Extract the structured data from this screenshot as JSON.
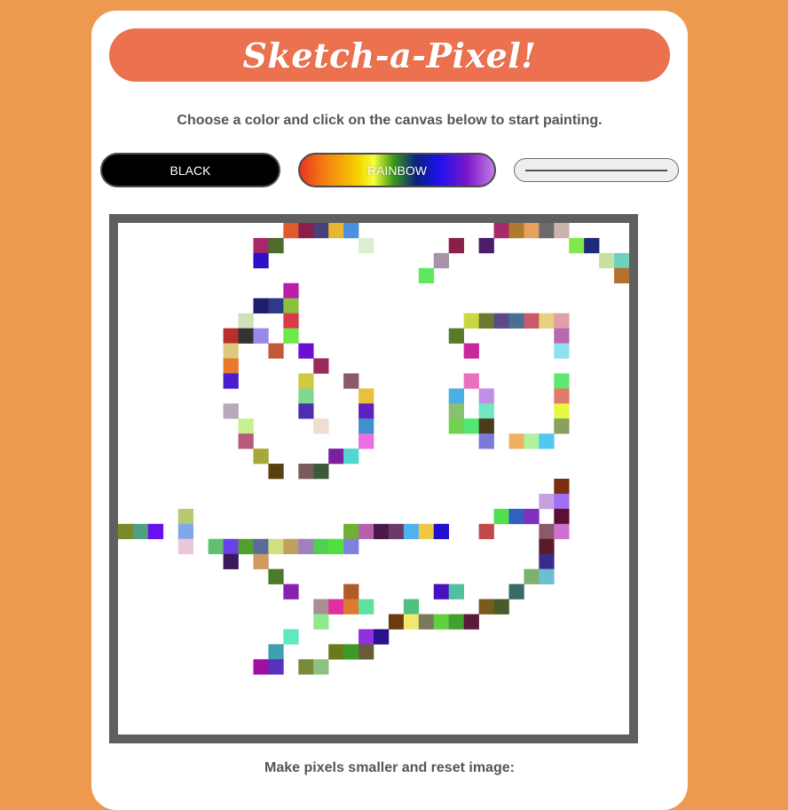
{
  "header": {
    "title": "Sketch-a-Pixel!"
  },
  "instructions": "Choose a color and click on the canvas below to start painting.",
  "controls": {
    "black_label": "BLACK",
    "rainbow_label": "RAINBOW"
  },
  "footer": {
    "text": "Make pixels smaller and reset image:"
  },
  "colors": {
    "page_background": "#ED9A50",
    "title_background": "#EC714E",
    "canvas_border": "#5f5f5f"
  },
  "canvas": {
    "columns": 34,
    "rows": 34,
    "cells": [
      [
        11,
        0,
        "#E05A2A"
      ],
      [
        12,
        0,
        "#8B1E4B"
      ],
      [
        13,
        0,
        "#4B3F7A"
      ],
      [
        14,
        0,
        "#E6B830"
      ],
      [
        15,
        0,
        "#4A8FE0"
      ],
      [
        25,
        0,
        "#A8286A"
      ],
      [
        26,
        0,
        "#B07A2E"
      ],
      [
        27,
        0,
        "#E8A060"
      ],
      [
        28,
        0,
        "#6B6B6B"
      ],
      [
        29,
        0,
        "#CCB3AD"
      ],
      [
        9,
        1,
        "#A8286A"
      ],
      [
        10,
        1,
        "#4F6B2E"
      ],
      [
        16,
        1,
        "#D9F0CF"
      ],
      [
        22,
        1,
        "#8B1E4B"
      ],
      [
        24,
        1,
        "#4A1E6B"
      ],
      [
        30,
        1,
        "#7FE84A"
      ],
      [
        31,
        1,
        "#1E2A7A"
      ],
      [
        9,
        2,
        "#2D10C8"
      ],
      [
        21,
        2,
        "#A893A8"
      ],
      [
        32,
        2,
        "#C5E0A0"
      ],
      [
        33,
        2,
        "#6FD0C0"
      ],
      [
        20,
        3,
        "#5FE85F"
      ],
      [
        33,
        3,
        "#B5702E"
      ],
      [
        11,
        4,
        "#B81EA8"
      ],
      [
        9,
        5,
        "#1E1E6B"
      ],
      [
        10,
        5,
        "#2E3A8C"
      ],
      [
        11,
        5,
        "#8CC040"
      ],
      [
        8,
        6,
        "#D0E0B8"
      ],
      [
        11,
        6,
        "#D93A4A"
      ],
      [
        23,
        6,
        "#C8D840"
      ],
      [
        24,
        6,
        "#6B7A2E"
      ],
      [
        25,
        6,
        "#5A4A8A"
      ],
      [
        26,
        6,
        "#4A7090"
      ],
      [
        27,
        6,
        "#C85A6A"
      ],
      [
        28,
        6,
        "#E8D080"
      ],
      [
        29,
        6,
        "#E0A0A8"
      ],
      [
        7,
        7,
        "#B8302A"
      ],
      [
        8,
        7,
        "#333333"
      ],
      [
        9,
        7,
        "#9B88E8"
      ],
      [
        11,
        7,
        "#6FE84A"
      ],
      [
        22,
        7,
        "#5A7A2A"
      ],
      [
        29,
        7,
        "#B86AB0"
      ],
      [
        7,
        8,
        "#E0C880"
      ],
      [
        10,
        8,
        "#C05A3A"
      ],
      [
        12,
        8,
        "#6A10D0"
      ],
      [
        23,
        8,
        "#C8289A"
      ],
      [
        29,
        8,
        "#8FE0F0"
      ],
      [
        7,
        9,
        "#E87A2A"
      ],
      [
        13,
        9,
        "#9A2A5A"
      ],
      [
        7,
        10,
        "#4A1ED0"
      ],
      [
        12,
        10,
        "#D0C840"
      ],
      [
        15,
        10,
        "#8A5A6A"
      ],
      [
        23,
        10,
        "#E870C0"
      ],
      [
        29,
        10,
        "#5FE870"
      ],
      [
        12,
        11,
        "#80D890"
      ],
      [
        16,
        11,
        "#E8C040"
      ],
      [
        22,
        11,
        "#4AB0E0"
      ],
      [
        24,
        11,
        "#C090E8"
      ],
      [
        29,
        11,
        "#E07A6A"
      ],
      [
        7,
        12,
        "#B8A8B8"
      ],
      [
        12,
        12,
        "#4A30B0"
      ],
      [
        16,
        12,
        "#6020C0"
      ],
      [
        22,
        12,
        "#8AC070"
      ],
      [
        24,
        12,
        "#70E8C0"
      ],
      [
        29,
        12,
        "#E8F840"
      ],
      [
        8,
        13,
        "#C8F090"
      ],
      [
        13,
        13,
        "#F0DDD0"
      ],
      [
        16,
        13,
        "#4090D0"
      ],
      [
        22,
        13,
        "#70D050"
      ],
      [
        23,
        13,
        "#50E870"
      ],
      [
        24,
        13,
        "#4A3A1E"
      ],
      [
        29,
        13,
        "#8AA060"
      ],
      [
        8,
        14,
        "#B85A7A"
      ],
      [
        16,
        14,
        "#E870E0"
      ],
      [
        24,
        14,
        "#7A7AD8"
      ],
      [
        26,
        14,
        "#F0B060"
      ],
      [
        27,
        14,
        "#B0F0A0"
      ],
      [
        28,
        14,
        "#50C8F0"
      ],
      [
        9,
        15,
        "#A8A83A"
      ],
      [
        14,
        15,
        "#7A20A0"
      ],
      [
        15,
        15,
        "#50D8D0"
      ],
      [
        10,
        16,
        "#5A4010"
      ],
      [
        12,
        16,
        "#7A5A5A"
      ],
      [
        13,
        16,
        "#3A5A3A"
      ],
      [
        29,
        17,
        "#7A3010"
      ],
      [
        28,
        18,
        "#C8A0E0"
      ],
      [
        29,
        18,
        "#A070F0"
      ],
      [
        4,
        19,
        "#B8C870"
      ],
      [
        25,
        19,
        "#50E050"
      ],
      [
        26,
        19,
        "#3060C0"
      ],
      [
        27,
        19,
        "#8030C0"
      ],
      [
        29,
        19,
        "#5A1030"
      ],
      [
        0,
        20,
        "#7A8A2A"
      ],
      [
        1,
        20,
        "#50A080"
      ],
      [
        2,
        20,
        "#6A10F0"
      ],
      [
        4,
        20,
        "#80A8E8"
      ],
      [
        15,
        20,
        "#70B030"
      ],
      [
        16,
        20,
        "#B860B0"
      ],
      [
        17,
        20,
        "#4A1A4A"
      ],
      [
        18,
        20,
        "#6A3A6A"
      ],
      [
        19,
        20,
        "#50B0F0"
      ],
      [
        20,
        20,
        "#F0C840"
      ],
      [
        21,
        20,
        "#2010D0"
      ],
      [
        24,
        20,
        "#C04A4A"
      ],
      [
        28,
        20,
        "#8A5A6A"
      ],
      [
        29,
        20,
        "#D070D0"
      ],
      [
        4,
        21,
        "#E8C8D8"
      ],
      [
        6,
        21,
        "#60C070"
      ],
      [
        7,
        21,
        "#6A40E8"
      ],
      [
        8,
        21,
        "#50A030"
      ],
      [
        9,
        21,
        "#5A6A9A"
      ],
      [
        10,
        21,
        "#D0E080"
      ],
      [
        11,
        21,
        "#C0A060"
      ],
      [
        12,
        21,
        "#A080C0"
      ],
      [
        13,
        21,
        "#50D050"
      ],
      [
        14,
        21,
        "#50E040"
      ],
      [
        15,
        21,
        "#8080E0"
      ],
      [
        28,
        21,
        "#5A1A2A"
      ],
      [
        7,
        22,
        "#3A1A5A"
      ],
      [
        9,
        22,
        "#D09A60"
      ],
      [
        28,
        22,
        "#3A2A8A"
      ],
      [
        10,
        23,
        "#4A7A2A"
      ],
      [
        27,
        23,
        "#80B070"
      ],
      [
        28,
        23,
        "#6AC0D0"
      ],
      [
        11,
        24,
        "#8A20B0"
      ],
      [
        15,
        24,
        "#B05A2A"
      ],
      [
        21,
        24,
        "#4A10C0"
      ],
      [
        22,
        24,
        "#50C0A0"
      ],
      [
        26,
        24,
        "#3A6A6A"
      ],
      [
        13,
        25,
        "#A89090"
      ],
      [
        14,
        25,
        "#E030A0"
      ],
      [
        15,
        25,
        "#E07A30"
      ],
      [
        16,
        25,
        "#60E0A0"
      ],
      [
        19,
        25,
        "#50C080"
      ],
      [
        24,
        25,
        "#7A5A1A"
      ],
      [
        25,
        25,
        "#4A5A2A"
      ],
      [
        13,
        26,
        "#90E890"
      ],
      [
        18,
        26,
        "#6A3A10"
      ],
      [
        19,
        26,
        "#F0E870"
      ],
      [
        20,
        26,
        "#7A7A5A"
      ],
      [
        21,
        26,
        "#60D040"
      ],
      [
        22,
        26,
        "#40A030"
      ],
      [
        23,
        26,
        "#5A1A3A"
      ],
      [
        11,
        27,
        "#60E8C0"
      ],
      [
        16,
        27,
        "#9030E0"
      ],
      [
        17,
        27,
        "#2A108A"
      ],
      [
        10,
        28,
        "#40A0B0"
      ],
      [
        14,
        28,
        "#6A7A1A"
      ],
      [
        15,
        28,
        "#3A9A2A"
      ],
      [
        16,
        28,
        "#6A5A3A"
      ],
      [
        9,
        29,
        "#A010A0"
      ],
      [
        10,
        29,
        "#5A30C0"
      ],
      [
        12,
        29,
        "#7A8A3A"
      ],
      [
        13,
        29,
        "#90C080"
      ]
    ]
  }
}
